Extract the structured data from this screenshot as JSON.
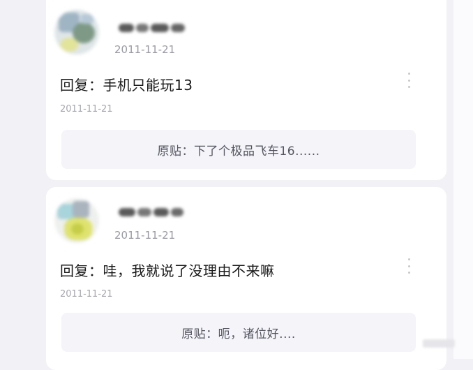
{
  "posts": [
    {
      "date": "2011-11-21",
      "reply": "回复：手机只能玩13",
      "reply_date": "2011-11-21",
      "quote": "原贴：下了个极品飞车16......"
    },
    {
      "date": "2011-11-21",
      "reply": "回复：哇，我就说了没理由不来嘛",
      "reply_date": "2011-11-21",
      "quote": "原贴：呃，诸位好...."
    }
  ],
  "icons": {
    "more": "more-vertical-icon",
    "avatar": "avatar-blurred",
    "username": "username-blurred"
  },
  "colors": {
    "background": "#f2f2f6",
    "card": "#ffffff",
    "quote_bg": "#f4f4f9",
    "date_text": "#9a9aa4",
    "body_text": "#1a1a1a"
  }
}
